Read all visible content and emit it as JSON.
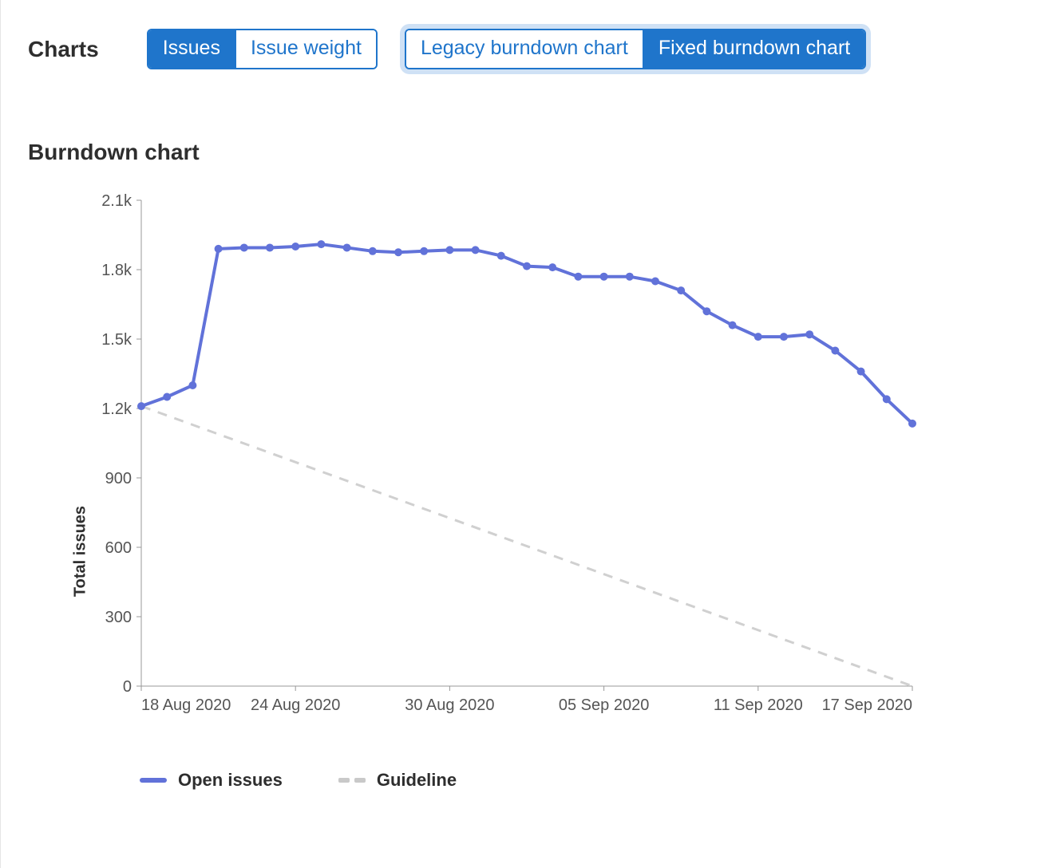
{
  "header": {
    "label": "Charts",
    "metric_toggle": {
      "issues": "Issues",
      "weight": "Issue weight",
      "active": "issues"
    },
    "chart_toggle": {
      "legacy": "Legacy burndown chart",
      "fixed": "Fixed burndown chart",
      "active": "fixed"
    }
  },
  "chart_title": "Burndown chart",
  "yaxis_title": "Total issues",
  "legend": {
    "open": "Open issues",
    "guideline": "Guideline"
  },
  "chart_data": {
    "type": "line",
    "title": "Burndown chart",
    "xlabel": "",
    "ylabel": "Total issues",
    "ylim": [
      0,
      2100
    ],
    "x_ticks": [
      "18 Aug 2020",
      "24 Aug 2020",
      "30 Aug 2020",
      "05 Sep 2020",
      "11 Sep 2020",
      "17 Sep 2020"
    ],
    "x_tick_indices": [
      0,
      6,
      12,
      18,
      24,
      30
    ],
    "y_ticks": [
      0,
      300,
      600,
      900,
      1200,
      1500,
      1800,
      2100
    ],
    "y_tick_labels": [
      "0",
      "300",
      "600",
      "900",
      "1.2k",
      "1.5k",
      "1.8k",
      "2.1k"
    ],
    "series": [
      {
        "name": "Open issues",
        "x": [
          0,
          1,
          2,
          3,
          4,
          5,
          6,
          7,
          8,
          9,
          10,
          11,
          12,
          13,
          14,
          15,
          16,
          17,
          18,
          19,
          20,
          21,
          22,
          23,
          24,
          25,
          26,
          27,
          28,
          29,
          30
        ],
        "values": [
          1210,
          1250,
          1300,
          1890,
          1895,
          1895,
          1900,
          1910,
          1895,
          1880,
          1875,
          1880,
          1885,
          1885,
          1860,
          1815,
          1810,
          1770,
          1770,
          1770,
          1750,
          1710,
          1620,
          1560,
          1510,
          1510,
          1520,
          1450,
          1360,
          1240,
          1135
        ]
      },
      {
        "name": "Guideline",
        "x": [
          0,
          30
        ],
        "values": [
          1210,
          0
        ],
        "style": "dashed"
      }
    ]
  }
}
